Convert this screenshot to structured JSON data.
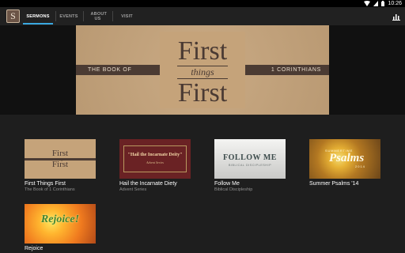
{
  "status_bar": {
    "time": "10:26"
  },
  "app": {
    "logo_letter": "S"
  },
  "tabs": [
    {
      "label": "SERMONS",
      "active": true
    },
    {
      "label": "EVENTS",
      "active": false
    },
    {
      "label": "ABOUT US",
      "active": false
    },
    {
      "label": "VISIT",
      "active": false
    }
  ],
  "hero": {
    "left_caption": "THE BOOK OF",
    "right_caption": "1 CORINTHIANS",
    "word_top": "First",
    "word_middle": "things",
    "word_bottom": "First"
  },
  "sermons": [
    {
      "title": "First Things First",
      "subtitle": "The Book of 1 Corinthians",
      "art_top": "First",
      "art_mid": "things",
      "art_bottom": "First"
    },
    {
      "title": "Hail the Incarnate Diety",
      "subtitle": "Advent Series",
      "art_title": "\"Hail the Incarnate Deity\"",
      "art_subtitle": "Advent Series"
    },
    {
      "title": "Follow Me",
      "subtitle": "Biblical Discipleship",
      "art_title": "FOLLOW ME",
      "art_subtitle": "BIBLICAL DISCIPLESHIP"
    },
    {
      "title": "Summer Psalms '14",
      "subtitle": "",
      "art_top": "SUMMERTIME",
      "art_title": "Psalms",
      "art_year": "2014"
    },
    {
      "title": "Rejoice",
      "subtitle": "",
      "art_title": "Rejoice!"
    }
  ],
  "colors": {
    "accent": "#3aa8e0",
    "app_bar": "#212121",
    "background": "#1e1e1e",
    "hero_tan": "#c5a37a",
    "ribbon_brown": "#4b3b33"
  }
}
